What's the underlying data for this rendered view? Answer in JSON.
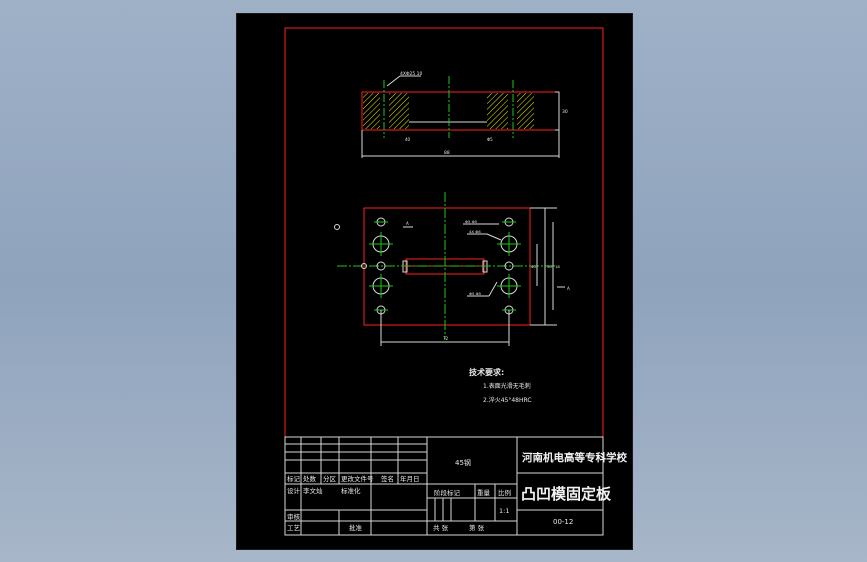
{
  "colors": {
    "background": "#93a6bf",
    "paper": "#000000",
    "border": "#ff1e1e",
    "geometry": "#d8d8d8",
    "centerline": "#18c818",
    "hatch": "#f0f000"
  },
  "top_view": {
    "callout": "4XΦ25 10",
    "width_dim": "88",
    "height_dim": "30",
    "hole_label_left": "40",
    "hole_label_right": "Φ5"
  },
  "plan_view": {
    "section_mark": "A",
    "callouts": [
      "Φ5 Φ5",
      "4X Φ8",
      "Φ5 Φ5"
    ],
    "dims": {
      "length": "72",
      "side_1": "50",
      "side_2": "40",
      "side_3": "18"
    }
  },
  "tech_notes": {
    "title": "技术要求:",
    "items": [
      "1.表面光滑无毛刺",
      "2.淬火45°48HRC"
    ]
  },
  "title_block": {
    "material": "45钢",
    "school": "河南机电高等专科学校",
    "part_name": "凸凹模固定板",
    "drawing_no": "00-12",
    "headers_row1": [
      "标记",
      "处数",
      "分区",
      "更改文件号",
      "签名",
      "年月日"
    ],
    "headers_row2": [
      "设计",
      "李文灿",
      "",
      "标准化"
    ],
    "review": "审核",
    "process": "工艺",
    "approve": "批准",
    "stage_label": "阶段标记",
    "weight_label": "重量",
    "scale_label": "比例",
    "scale_value": "1:1",
    "sheets_label": "共 张",
    "sheet_label": "第 张"
  }
}
